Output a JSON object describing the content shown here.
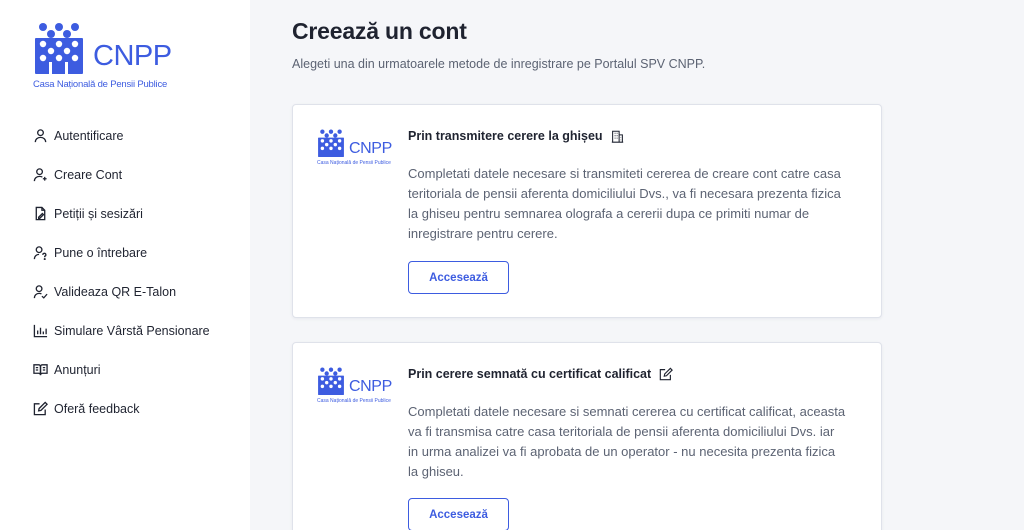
{
  "brand": {
    "name": "CNPP",
    "subtitle": "Casa Națională de Pensii Publice",
    "accent_color": "#3d5ce0"
  },
  "sidebar": {
    "items": [
      {
        "label": "Autentificare",
        "icon": "user-icon"
      },
      {
        "label": "Creare Cont",
        "icon": "user-plus-icon"
      },
      {
        "label": "Petiții și sesizări",
        "icon": "document-pen-icon"
      },
      {
        "label": "Pune o întrebare",
        "icon": "user-question-icon"
      },
      {
        "label": "Valideaza QR E-Talon",
        "icon": "user-check-icon"
      },
      {
        "label": "Simulare Vârstă Pensionare",
        "icon": "bar-chart-icon"
      },
      {
        "label": "Anunțuri",
        "icon": "open-book-icon"
      },
      {
        "label": "Oferă feedback",
        "icon": "edit-icon"
      }
    ]
  },
  "main": {
    "title": "Creează un cont",
    "subtitle": "Alegeti una din urmatoarele metode de inregistrare pe Portalul SPV CNPP.",
    "cards": [
      {
        "title": "Prin transmitere cerere la ghișeu",
        "title_icon": "building-icon",
        "description": "Completati datele necesare si transmiteti cererea de creare cont catre casa teritoriala de pensii aferenta domiciliului Dvs., va fi necesara prezenta fizica la ghiseu pentru semnarea olografa a cererii dupa ce primiti numar de inregistrare pentru cerere.",
        "button": "Accesează"
      },
      {
        "title": "Prin cerere semnată cu certificat calificat",
        "title_icon": "pen-square-icon",
        "description": "Completati datele necesare si semnati cererea cu certificat calificat, aceasta va fi transmisa catre casa teritoriala de pensii aferenta domiciliului Dvs. iar in urma analizei va fi aprobata de un operator - nu necesita prezenta fizica la ghiseu.",
        "button": "Accesează"
      }
    ]
  }
}
